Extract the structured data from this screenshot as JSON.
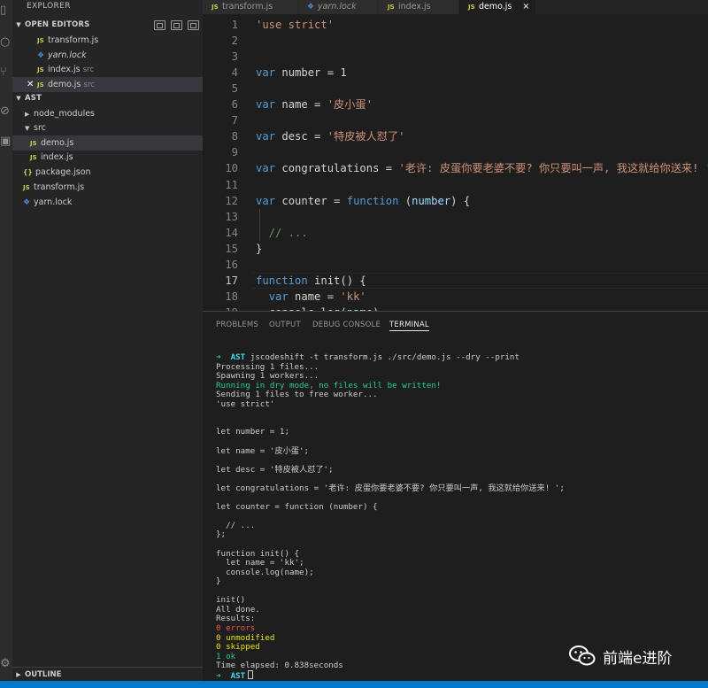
{
  "sidebar": {
    "title": "EXPLORER",
    "open_editors": {
      "header": "OPEN EDITORS",
      "items": [
        {
          "label": "transform.js",
          "hint": "",
          "icon": "js-icon"
        },
        {
          "label": "yarn.lock",
          "hint": "",
          "icon": "yarn-icon"
        },
        {
          "label": "index.js",
          "hint": "src",
          "icon": "js-icon"
        },
        {
          "label": "demo.js",
          "hint": "src",
          "icon": "js-icon"
        }
      ]
    },
    "project": {
      "header": "AST",
      "items": [
        {
          "label": "node_modules",
          "kind": "folder-collapsed"
        },
        {
          "label": "src",
          "kind": "folder-open"
        },
        {
          "label": "demo.js",
          "kind": "js"
        },
        {
          "label": "index.js",
          "kind": "js"
        },
        {
          "label": "package.json",
          "kind": "json",
          "icon_text": "{}"
        },
        {
          "label": "transform.js",
          "kind": "js"
        },
        {
          "label": "yarn.lock",
          "kind": "yarn"
        }
      ]
    },
    "outline_header": "OUTLINE",
    "js_badge": "JS"
  },
  "tabs": [
    {
      "label": "transform.js",
      "italic": false
    },
    {
      "label": "yarn.lock",
      "italic": true
    },
    {
      "label": "index.js",
      "italic": false
    },
    {
      "label": "demo.js",
      "italic": false,
      "active": true,
      "close": "×"
    }
  ],
  "editor": {
    "current_line": 17,
    "lines": [
      {
        "n": "1",
        "code": "'use strict'"
      },
      {
        "n": "2",
        "code": ""
      },
      {
        "n": "3",
        "code": ""
      },
      {
        "n": "4",
        "code": "var number = 1"
      },
      {
        "n": "5",
        "code": ""
      },
      {
        "n": "6",
        "code": "var name = '皮小蛋'"
      },
      {
        "n": "7",
        "code": ""
      },
      {
        "n": "8",
        "code": "var desc = '特皮被人怼了'"
      },
      {
        "n": "9",
        "code": ""
      },
      {
        "n": "10",
        "code": "var congratulations = '老许: 皮蛋你要老婆不要? 你只要叫一声, 我这就给你送来! '"
      },
      {
        "n": "11",
        "code": ""
      },
      {
        "n": "12",
        "code": "var counter = function (number) {"
      },
      {
        "n": "13",
        "code": ""
      },
      {
        "n": "14",
        "code": "  // ..."
      },
      {
        "n": "15",
        "code": "}"
      },
      {
        "n": "16",
        "code": ""
      },
      {
        "n": "17",
        "code": "function init() {"
      },
      {
        "n": "18",
        "code": "  var name = 'kk'"
      },
      {
        "n": "19",
        "code": "  console.log(name)"
      }
    ]
  },
  "panel": {
    "tabs": [
      "PROBLEMS",
      "OUTPUT",
      "DEBUG CONSOLE",
      "TERMINAL"
    ],
    "active_tab": "TERMINAL",
    "terminal": {
      "prompt_arrow": "➜",
      "prompt_dir": "AST",
      "command": "jscodeshift -t transform.js ./src/demo.js --dry --print",
      "lines": [
        {
          "text": "Processing 1 files...",
          "color": "default"
        },
        {
          "text": "Spawning 1 workers...",
          "color": "default"
        },
        {
          "text": "Running in dry mode, no files will be written!",
          "color": "green"
        },
        {
          "text": "Sending 1 files to free worker...",
          "color": "default"
        },
        {
          "text": "'use strict'",
          "color": "default"
        },
        {
          "text": "",
          "color": "default"
        },
        {
          "text": "",
          "color": "default"
        },
        {
          "text": "let number = 1;",
          "color": "default"
        },
        {
          "text": "",
          "color": "default"
        },
        {
          "text": "let name = '皮小蛋';",
          "color": "default"
        },
        {
          "text": "",
          "color": "default"
        },
        {
          "text": "let desc = '特皮被人怼了';",
          "color": "default"
        },
        {
          "text": "",
          "color": "default"
        },
        {
          "text": "let congratulations = '老许: 皮蛋你要老婆不要? 你只要叫一声, 我这就给你送来! ';",
          "color": "default"
        },
        {
          "text": "",
          "color": "default"
        },
        {
          "text": "let counter = function (number) {",
          "color": "default"
        },
        {
          "text": "",
          "color": "default"
        },
        {
          "text": "  // ...",
          "color": "default"
        },
        {
          "text": "};",
          "color": "default"
        },
        {
          "text": "",
          "color": "default"
        },
        {
          "text": "function init() {",
          "color": "default"
        },
        {
          "text": "  let name = 'kk';",
          "color": "default"
        },
        {
          "text": "  console.log(name);",
          "color": "default"
        },
        {
          "text": "}",
          "color": "default"
        },
        {
          "text": "",
          "color": "default"
        },
        {
          "text": "init()",
          "color": "default"
        },
        {
          "text": "All done.",
          "color": "default"
        },
        {
          "text": "Results:",
          "color": "default"
        },
        {
          "text": "0 errors",
          "color": "red"
        },
        {
          "text": "0 unmodified",
          "color": "yellow"
        },
        {
          "text": "0 skipped",
          "color": "yellow"
        },
        {
          "text": "1 ok",
          "color": "green"
        },
        {
          "text": "Time elapsed: 0.838seconds",
          "color": "default"
        }
      ]
    }
  },
  "watermark": {
    "text": "前端e进阶",
    "icon": "wechat-icon"
  },
  "colors": {
    "keyword": "#569cd6",
    "string": "#ce9178",
    "comment": "#6a9955",
    "status_bar": "#007acc",
    "sidebar_bg": "#252526",
    "editor_bg": "#1e1e1e"
  }
}
